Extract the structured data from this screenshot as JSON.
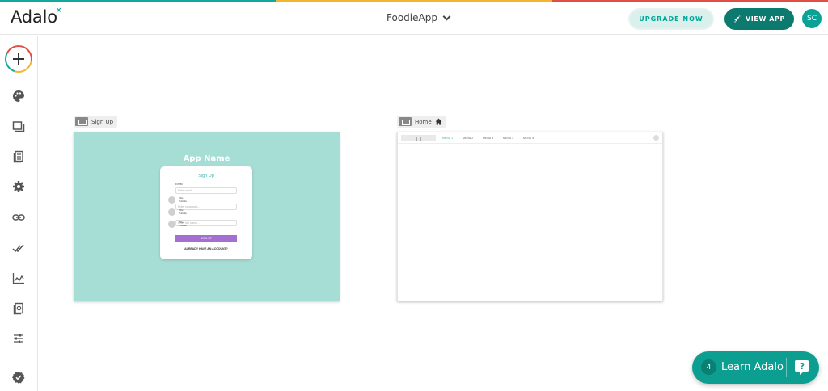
{
  "colors": {
    "stripe": [
      "#12a89d",
      "#f4b531",
      "#e04f44"
    ],
    "brand": "#0c7a6e",
    "accent": "#00a898",
    "signup_bg": "#a6ddd5",
    "signup_button": "#a56fd1"
  },
  "header": {
    "logo": "Adalo",
    "logo_mark": "×",
    "app_name": "FoodieApp",
    "upgrade_label": "UPGRADE NOW",
    "view_app_label": "VIEW APP",
    "avatar_initials": "SC"
  },
  "sidebar": {
    "items": [
      {
        "icon": "add-icon"
      },
      {
        "icon": "palette-icon"
      },
      {
        "icon": "screens-icon"
      },
      {
        "icon": "database-icon"
      },
      {
        "icon": "settings-icon"
      },
      {
        "icon": "link-icon"
      },
      {
        "icon": "publish-check-icon"
      },
      {
        "icon": "analytics-icon"
      },
      {
        "icon": "templates-icon"
      },
      {
        "icon": "sliders-icon"
      },
      {
        "icon": "verified-icon"
      }
    ]
  },
  "screens": {
    "signup": {
      "label": "Sign Up",
      "app_name": "App Name",
      "card_title": "Sign Up",
      "field_email_label": "Email",
      "field_email_placeholder": "Enter email...",
      "field_password_placeholder": "Enter password...",
      "field_name_placeholder": "Enter full name...",
      "circle_label_1": "Title",
      "circle_sub_1": "Subtitle",
      "circle_label_2": "Title",
      "circle_sub_2": "Subtitle",
      "circle_label_3": "Title",
      "circle_sub_3": "Subtitle",
      "button_label": "SIGN UP",
      "link_label": "ALREADY HAVE AN ACCOUNT?"
    },
    "home": {
      "label": "Home",
      "menu": [
        "MENU 1",
        "MENU 2",
        "MENU 3",
        "MENU 4",
        "MENU 5"
      ]
    }
  },
  "learn": {
    "count": "4",
    "label": "Learn Adalo"
  }
}
